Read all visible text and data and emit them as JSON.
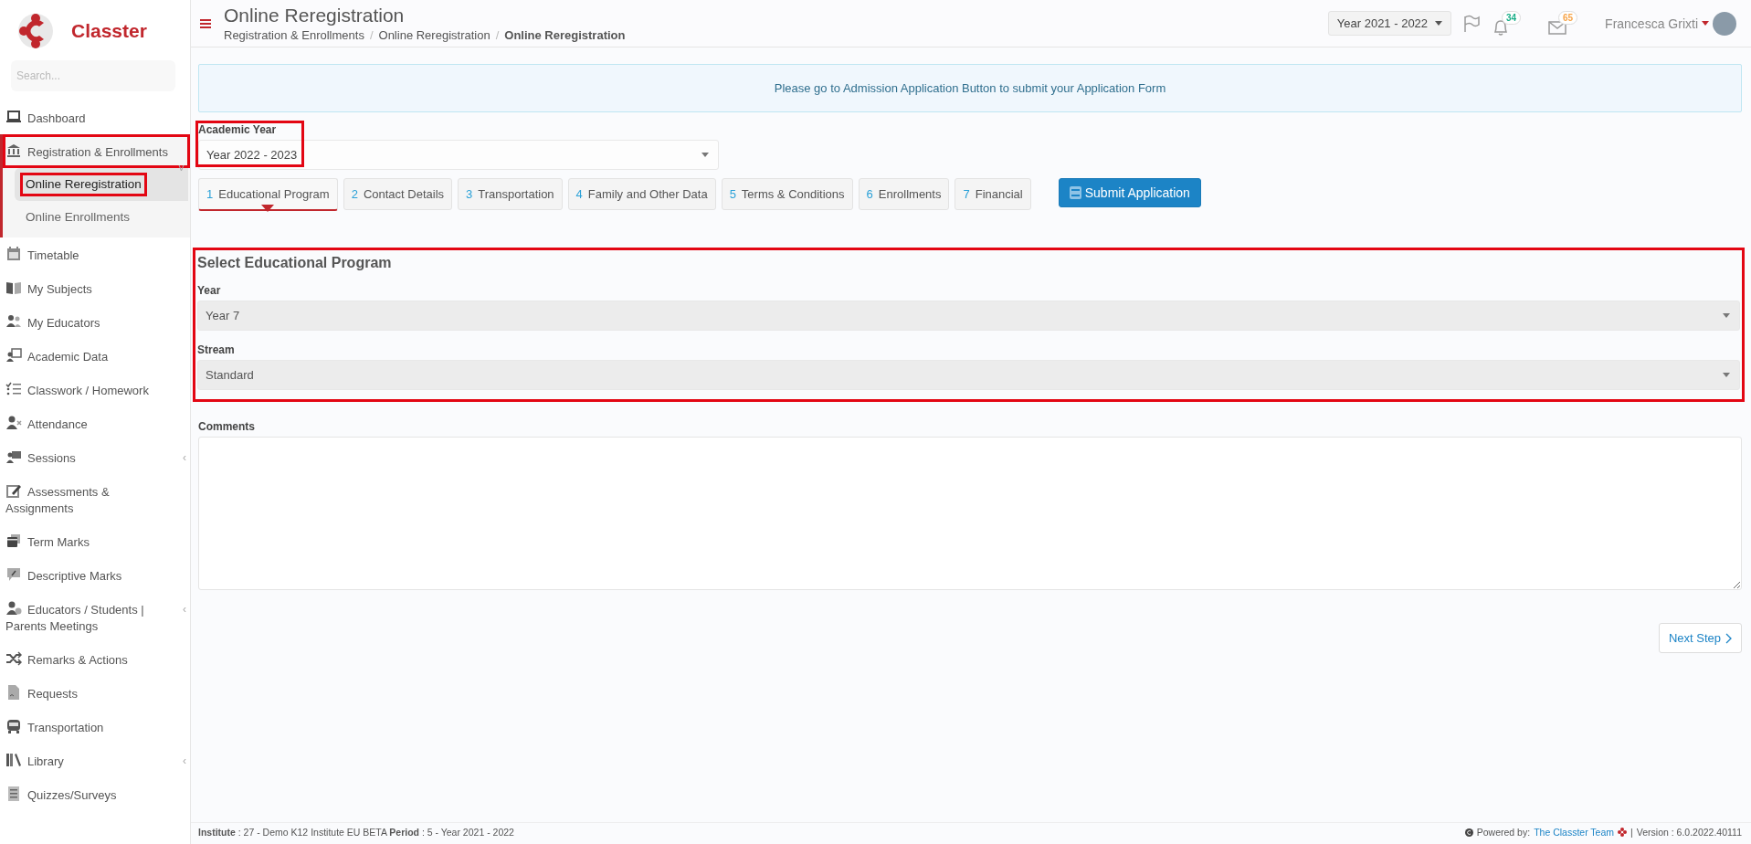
{
  "brand": {
    "name": "Classter"
  },
  "sidebar": {
    "search": {
      "placeholder": "Search..."
    },
    "items": [
      {
        "label": "Dashboard",
        "selected": false,
        "highlighted": false
      },
      {
        "label": "Registration & Enrollments",
        "selected": false,
        "highlighted": true,
        "expanded": true,
        "chevron": "˅",
        "children": [
          {
            "label": "Online Reregistration",
            "selected": true,
            "highlighted": true
          },
          {
            "label": "Online Enrollments",
            "selected": false,
            "highlighted": false
          }
        ]
      },
      {
        "label": "Timetable",
        "selected": false,
        "highlighted": false
      },
      {
        "label": "My Subjects",
        "selected": false,
        "highlighted": false
      },
      {
        "label": "My Educators",
        "selected": false,
        "highlighted": false
      },
      {
        "label": "Academic Data",
        "selected": false,
        "highlighted": false
      },
      {
        "label": "Classwork / Homework",
        "selected": false,
        "highlighted": false
      },
      {
        "label": "Attendance",
        "selected": false,
        "highlighted": false
      },
      {
        "label": "Sessions",
        "selected": false,
        "highlighted": false,
        "chevron": "‹"
      },
      {
        "label": "Assessments & Assignments",
        "selected": false,
        "highlighted": false
      },
      {
        "label": "Term Marks",
        "selected": false,
        "highlighted": false
      },
      {
        "label": "Descriptive Marks",
        "selected": false,
        "highlighted": false
      },
      {
        "label": "Educators / Students | Parents Meetings",
        "selected": false,
        "highlighted": false,
        "chevron": "‹"
      },
      {
        "label": "Remarks & Actions",
        "selected": false,
        "highlighted": false
      },
      {
        "label": "Requests",
        "selected": false,
        "highlighted": false
      },
      {
        "label": "Transportation",
        "selected": false,
        "highlighted": false
      },
      {
        "label": "Library",
        "selected": false,
        "highlighted": false,
        "chevron": "‹"
      },
      {
        "label": "Quizzes/Surveys",
        "selected": false,
        "highlighted": false
      }
    ]
  },
  "header": {
    "title": "Online Reregistration",
    "breadcrumb_separator": "/",
    "breadcrumbs": [
      {
        "label": "Registration & Enrollments",
        "current": false
      },
      {
        "label": "Online Reregistration",
        "current": false
      },
      {
        "label": "Online Reregistration",
        "current": true
      }
    ],
    "year_selector": "Year 2021 - 2022",
    "notifications": [
      {
        "kind": "bell",
        "count": "34",
        "color": "#1aae88"
      },
      {
        "kind": "mail",
        "count": "65",
        "color": "#f7a54a"
      }
    ],
    "user": {
      "name": "Francesca Grixti"
    }
  },
  "alert": {
    "text": "Please go to Admission Application Button to submit your Application Form"
  },
  "academic_year": {
    "label": "Academic Year",
    "value": "Year 2022 - 2023",
    "highlighted": true
  },
  "tabs": [
    {
      "number": "1",
      "label": "Educational Program",
      "selected": true
    },
    {
      "number": "2",
      "label": "Contact Details",
      "selected": false
    },
    {
      "number": "3",
      "label": "Transportation",
      "selected": false
    },
    {
      "number": "4",
      "label": "Family and Other Data",
      "selected": false
    },
    {
      "number": "5",
      "label": "Terms & Conditions",
      "selected": false
    },
    {
      "number": "6",
      "label": "Enrollments",
      "selected": false
    },
    {
      "number": "7",
      "label": "Financial",
      "selected": false
    }
  ],
  "submit_button": "Submit Application",
  "program": {
    "title": "Select Educational Program",
    "highlighted": true,
    "fields": [
      {
        "label": "Year",
        "value": "Year 7",
        "disabled": true
      },
      {
        "label": "Stream",
        "value": "Standard",
        "disabled": true
      }
    ]
  },
  "comments": {
    "label": "Comments"
  },
  "next_button": "Next Step",
  "footer": {
    "info": "**Institute** : 27 - Demo K12 Institute EU BETA **Period** : 5 - Year 2021 - 2022",
    "powered_by": "Powered by:",
    "link": "The Classter Team",
    "separator": "|",
    "version": "Version : 6.0.2022.40111"
  }
}
